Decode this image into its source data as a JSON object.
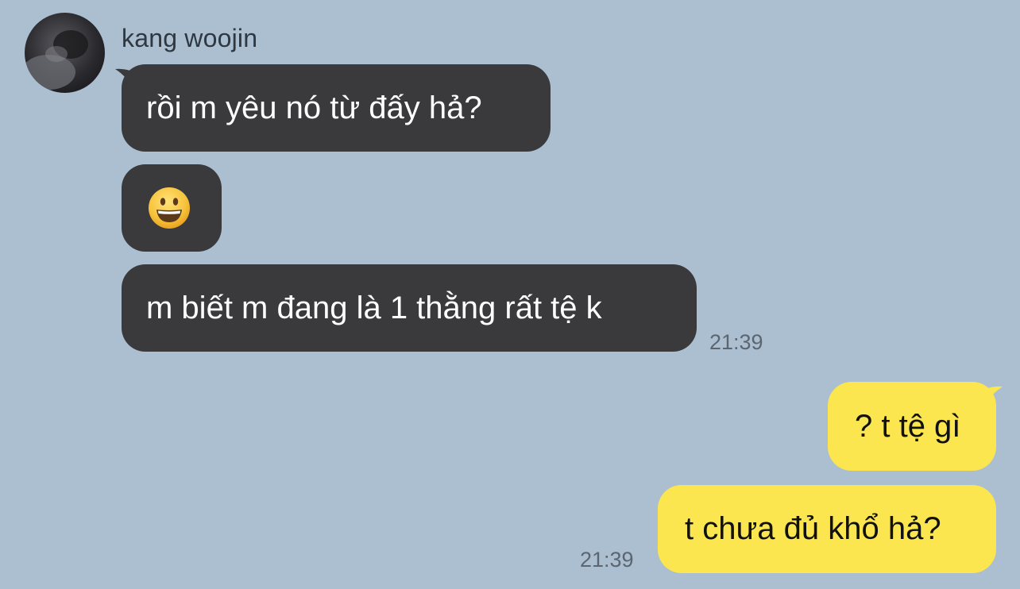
{
  "chat": {
    "contact_name": "kang woojin",
    "incoming": [
      {
        "text": "rồi m yêu nó từ đấy hả?"
      },
      {
        "emoji": "grinning-face-emoji"
      },
      {
        "text": "m biết m đang là 1 thằng rất tệ k"
      }
    ],
    "incoming_time": "21:39",
    "outgoing": [
      {
        "text": "? t tệ gì"
      },
      {
        "text": "t chưa đủ khổ hả?"
      }
    ],
    "outgoing_time": "21:39"
  },
  "colors": {
    "background": "#acbfd0",
    "incoming_bubble": "#3a3a3c",
    "outgoing_bubble": "#fbe64f",
    "timestamp": "#5b6671"
  }
}
